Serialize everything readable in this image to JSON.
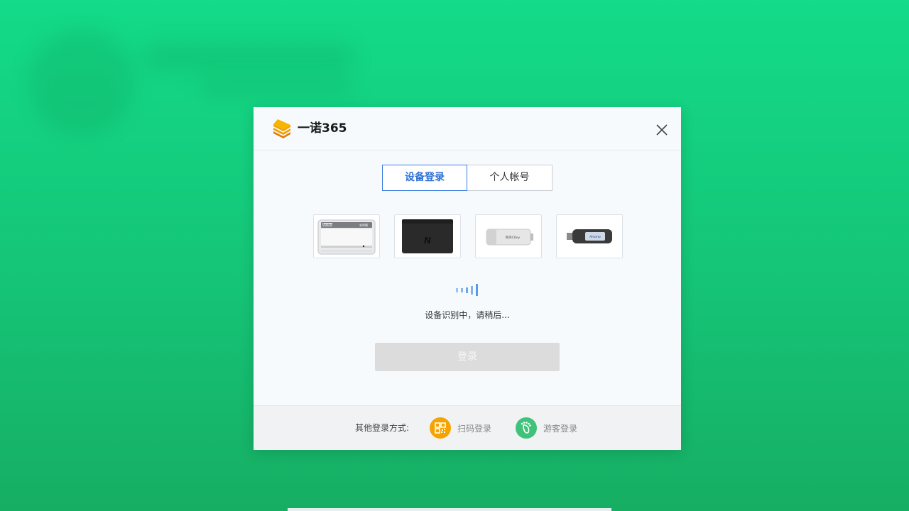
{
  "app": {
    "title": "一诺365"
  },
  "tabs": [
    {
      "label": "设备登录",
      "active": true
    },
    {
      "label": "个人帐号",
      "active": false
    }
  ],
  "devices": [
    {
      "name": "card-reader",
      "label_brand": "Anxino",
      "label_text": "金凤凰"
    },
    {
      "name": "nfc-reader",
      "label_mark": "N"
    },
    {
      "name": "usb-key-white",
      "label_text": "税务CKey"
    },
    {
      "name": "usb-key-black",
      "label_brand": "Anxino"
    }
  ],
  "status": {
    "text": "设备识别中，请稍后..."
  },
  "login_button": {
    "label": "登录"
  },
  "footer": {
    "other_label": "其他登录方式:",
    "qr_label": "扫码登录",
    "guest_label": "游客登录"
  },
  "colors": {
    "accent": "#2d6fd6",
    "qr_icon": "#f5a300",
    "guest_icon": "#3fc27a",
    "background": "#13db88"
  },
  "icons": {
    "logo": "stacked-layers-icon",
    "close": "close-icon",
    "signal": "signal-bars-icon",
    "qr": "qr-code-icon",
    "guest": "footprint-icon"
  }
}
